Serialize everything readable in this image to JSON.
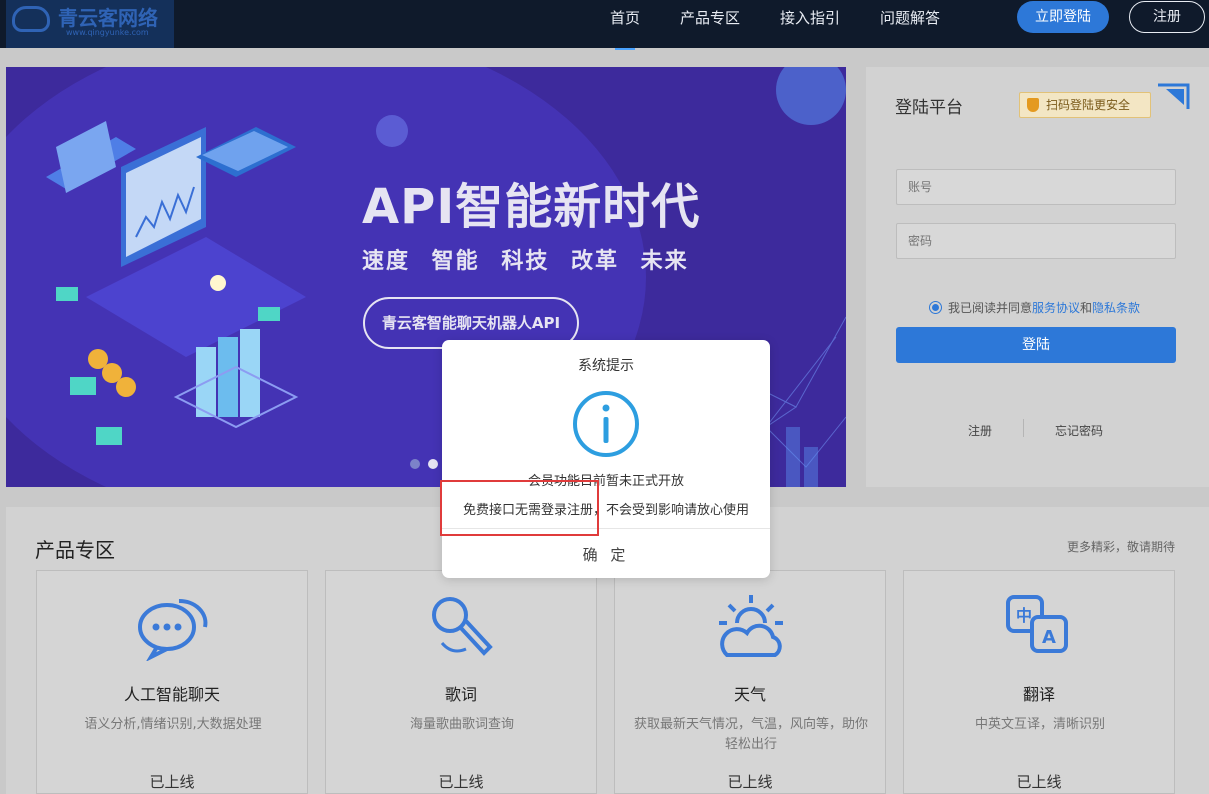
{
  "header": {
    "logo_text": "青云客网络",
    "logo_sub": "www.qingyunke.com",
    "nav": [
      {
        "label": "首页",
        "active": true
      },
      {
        "label": "产品专区",
        "active": false
      },
      {
        "label": "接入指引",
        "active": false
      },
      {
        "label": "问题解答",
        "active": false
      }
    ],
    "login_button": "立即登陆",
    "register_button": "注册"
  },
  "banner": {
    "title": "API智能新时代",
    "subtitle": "速度 智能 科技 改革 未来",
    "pill": "青云客智能聊天机器人API",
    "slide_count": 2,
    "active_slide": 1
  },
  "login": {
    "title": "登陆平台",
    "secure_badge": "扫码登陆更安全",
    "account_placeholder": "账号",
    "password_placeholder": "密码",
    "agree_prefix": "我已阅读并同意",
    "agree_link1": "服务协议",
    "agree_and": "和",
    "agree_link2": "隐私条款",
    "submit": "登陆",
    "register_link": "注册",
    "forgot_link": "忘记密码"
  },
  "products": {
    "title": "产品专区",
    "more": "更多精彩，敬请期待",
    "cards": [
      {
        "icon": "chat-icon",
        "name": "人工智能聊天",
        "desc": "语义分析,情绪识别,大数据处理",
        "status": "已上线"
      },
      {
        "icon": "microphone-icon",
        "name": "歌词",
        "desc": "海量歌曲歌词查询",
        "status": "已上线"
      },
      {
        "icon": "weather-icon",
        "name": "天气",
        "desc": "获取最新天气情况，气温，风向等，助你轻松出行",
        "status": "已上线"
      },
      {
        "icon": "translate-icon",
        "name": "翻译",
        "desc": "中英文互译，清晰识别",
        "status": "已上线"
      }
    ]
  },
  "modal": {
    "title": "系统提示",
    "line1": "会员功能目前暂未正式开放",
    "line2": "免费接口无需登录注册，不会受到影响请放心使用",
    "ok": "确 定"
  },
  "colors": {
    "accent": "#2d78d8",
    "header_bg": "#0f1a2b",
    "banner_bg": "#3d2a9c",
    "highlight": "#e03b3b"
  }
}
